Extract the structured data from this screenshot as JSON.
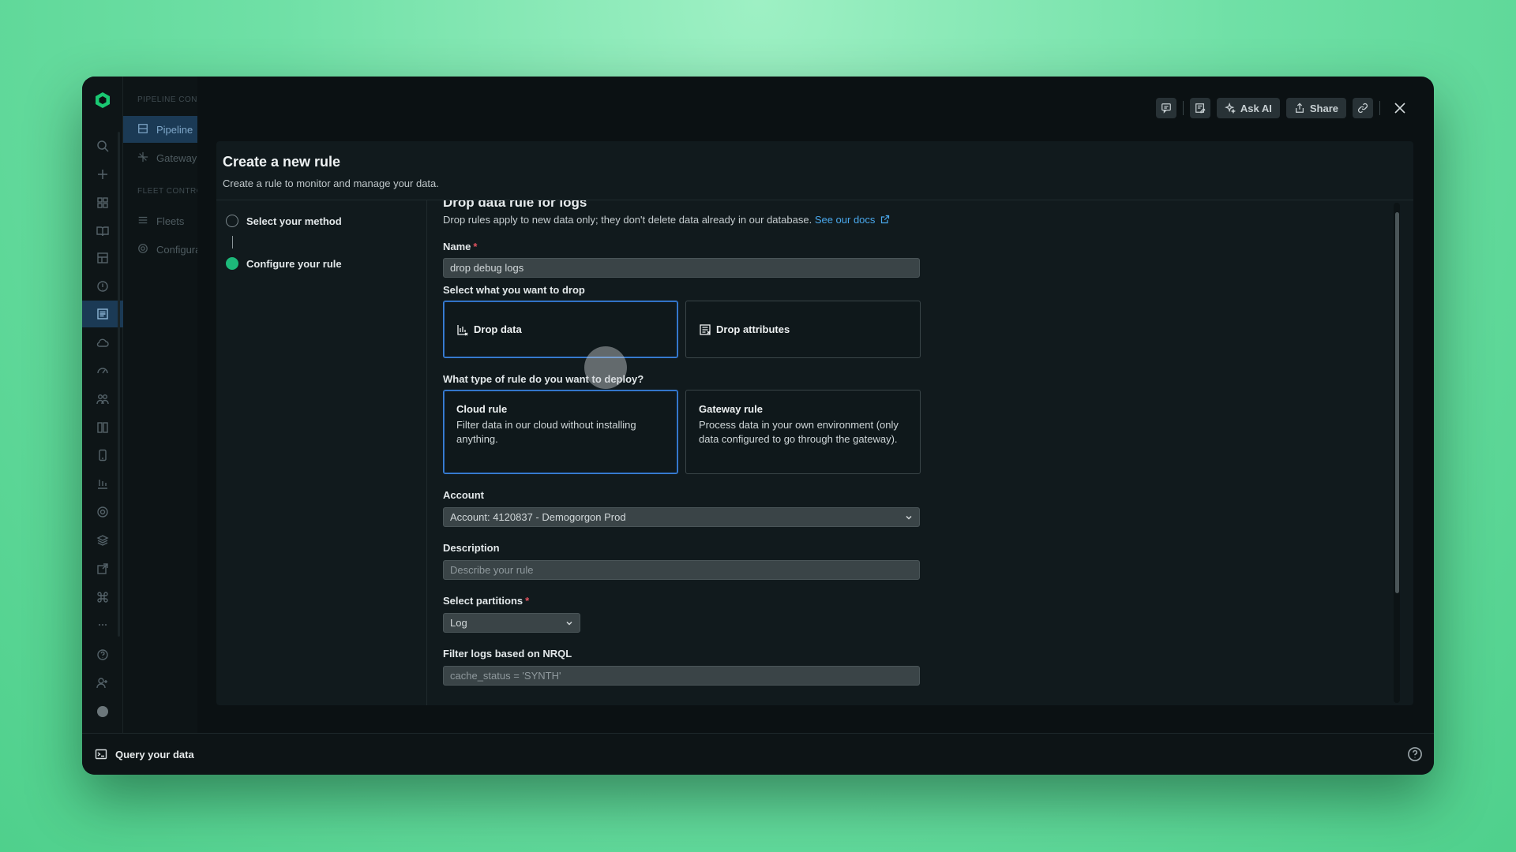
{
  "rail": {
    "icons": [
      "search-icon",
      "plus-icon",
      "apps-icon",
      "book-icon",
      "dashboard-icon",
      "alert-icon",
      "logs-icon",
      "cloud-icon",
      "gauge-icon",
      "people-icon",
      "columns-icon",
      "mobile-icon",
      "stack-icon",
      "settings-icon",
      "layers-icon",
      "export-icon",
      "command-icon",
      "more-icon",
      "help-icon",
      "add-user-icon",
      "avatar-icon"
    ]
  },
  "nav": {
    "section1": "PIPELINE CONTROL",
    "item_pipeline": "Pipeline",
    "item_gateway": "Gateway",
    "section2": "FLEET CONTROL",
    "item_fleets": "Fleets",
    "item_config": "Configurations"
  },
  "toolbar": {
    "ask_ai": "Ask AI",
    "share": "Share"
  },
  "panel": {
    "title": "Create a new rule",
    "subtitle": "Create a rule to monitor and manage your data."
  },
  "steps": {
    "step1": "Select your method",
    "step2": "Configure your rule"
  },
  "form": {
    "heading": "Drop data rule for logs",
    "description": "Drop rules apply to new data only; they don't delete data already in our database.",
    "docs_link": "See our docs",
    "name_label": "Name",
    "name_value": "drop debug logs",
    "drop_label": "Select what you want to drop",
    "drop_data": "Drop data",
    "drop_attributes": "Drop attributes",
    "rule_type_label": "What type of rule do you want to deploy?",
    "cloud_title": "Cloud rule",
    "cloud_desc": "Filter data in our cloud without installing anything.",
    "gateway_title": "Gateway rule",
    "gateway_desc": "Process data in your own environment (only data configured to go through the gateway).",
    "account_label": "Account",
    "account_value": "Account: 4120837 - Demogorgon Prod",
    "description_label": "Description",
    "description_placeholder": "Describe your rule",
    "partitions_label": "Select partitions",
    "partitions_value": "Log",
    "nrql_label": "Filter logs based on NRQL",
    "nrql_placeholder": "cache_status = 'SYNTH'"
  },
  "bottom": {
    "query_label": "Query your data"
  },
  "colors": {
    "accent": "#3b80d6",
    "success": "#1db97a",
    "link": "#4aa8ec",
    "required": "#e0525e"
  }
}
